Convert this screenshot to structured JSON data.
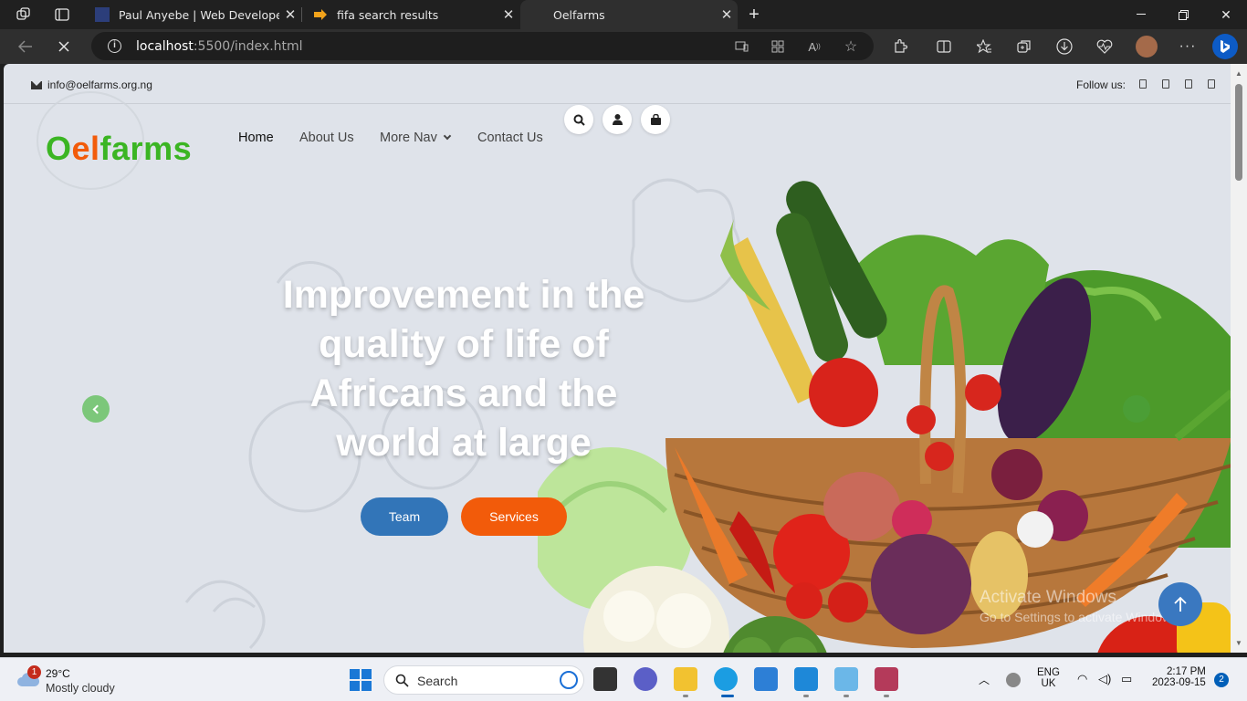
{
  "browser": {
    "tabs": [
      {
        "title": "Paul Anyebe | Web Developer",
        "active": false
      },
      {
        "title": "fifa search results",
        "active": false
      },
      {
        "title": "Oelfarms",
        "active": true
      }
    ],
    "url_host": "localhost",
    "url_path": ":5500/index.html"
  },
  "site": {
    "email": "info@oelfarms.org.ng",
    "follow_label": "Follow us:",
    "logo": {
      "part1": "O",
      "part2": "el",
      "part3": "farms"
    },
    "nav": [
      {
        "label": "Home"
      },
      {
        "label": "About Us"
      },
      {
        "label": "More Nav"
      },
      {
        "label": "Contact Us"
      }
    ],
    "hero": {
      "title": "Improvement in the quality of life of Africans and the world at large",
      "btn_team": "Team",
      "btn_services": "Services"
    },
    "colors": {
      "green": "#3bb523",
      "orange": "#f25b0a",
      "blue": "#3275b8"
    }
  },
  "watermark": {
    "line1": "Activate Windows",
    "line2": "Go to Settings to activate Windows."
  },
  "taskbar": {
    "weather_badge": "1",
    "temperature": "29°C",
    "weather_desc": "Mostly cloudy",
    "search_label": "Search",
    "lang1": "ENG",
    "lang2": "UK",
    "time": "2:17 PM",
    "date": "2023-09-15",
    "notifications": "2"
  }
}
